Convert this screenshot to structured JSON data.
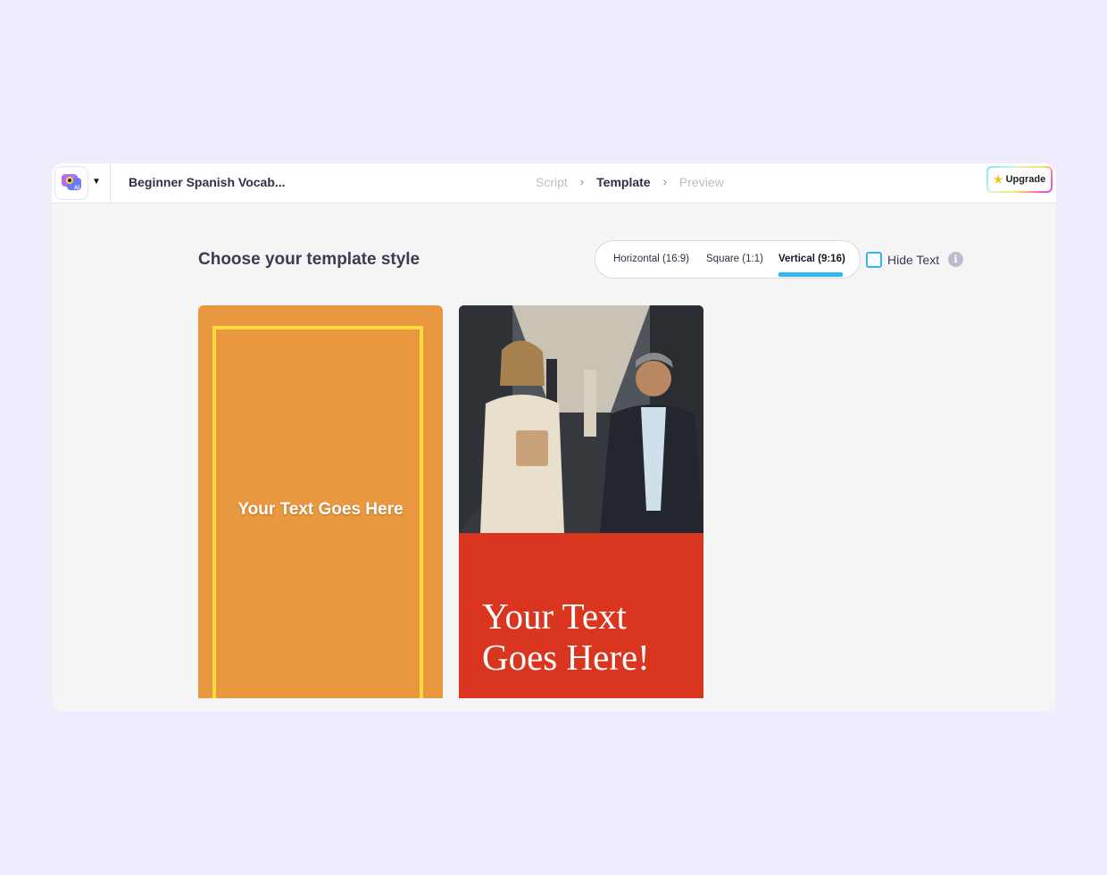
{
  "topbar": {
    "project_title": "Beginner Spanish Vocab...",
    "steps": [
      {
        "label": "Script",
        "state": "inactive"
      },
      {
        "label": "Template",
        "state": "active"
      },
      {
        "label": "Preview",
        "state": "inactive"
      }
    ],
    "step_separator_icon": "chevron-right-icon",
    "upgrade_label": "Upgrade",
    "upgrade_icon": "star-icon",
    "logo_icon": "ai-video-app-logo-icon",
    "logo_dropdown_icon": "chevron-down-icon"
  },
  "main": {
    "heading": "Choose your template style",
    "aspect_tabs": [
      {
        "label": "Horizontal (16:9)",
        "active": false
      },
      {
        "label": "Square (1:1)",
        "active": false
      },
      {
        "label": "Vertical (9:16)",
        "active": true
      }
    ],
    "hide_text": {
      "label": "Hide Text",
      "checked": false,
      "info_icon": "info-icon"
    },
    "templates": [
      {
        "name": "orange-frame",
        "text": "Your Text Goes Here"
      },
      {
        "name": "photo-red",
        "text": "Your Text Goes Here!"
      }
    ]
  },
  "colors": {
    "background": "#efecfd",
    "accent": "#35b6f4",
    "orange_template": "#e9983f",
    "orange_frame": "#ffd93d",
    "red_template": "#d9351f"
  }
}
